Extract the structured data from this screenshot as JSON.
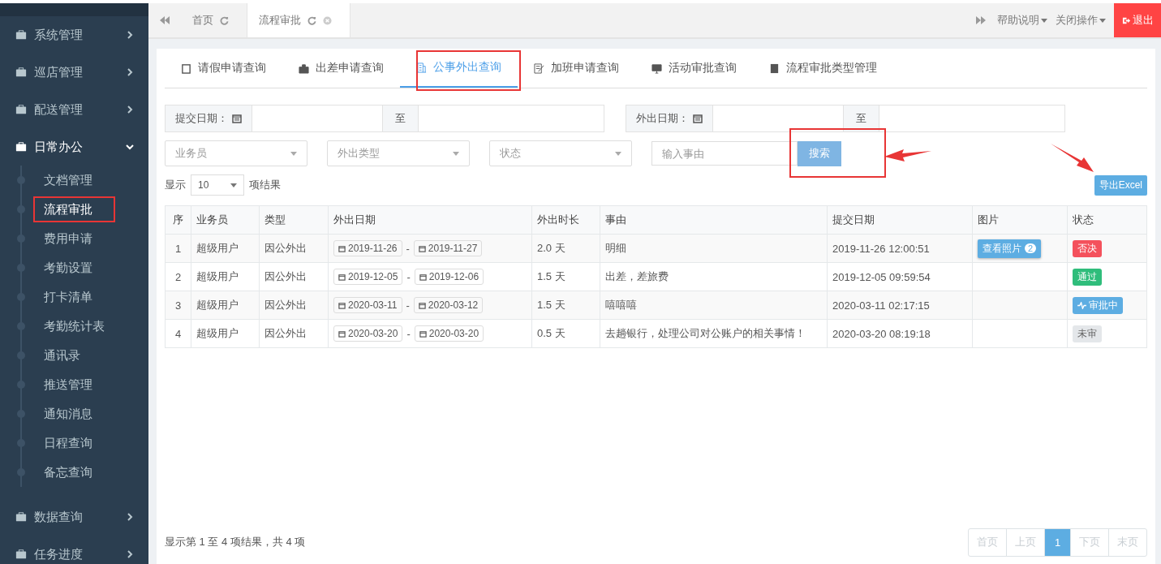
{
  "sidebar": {
    "items": [
      {
        "label": "系统管理",
        "expanded": false
      },
      {
        "label": "巡店管理",
        "expanded": false
      },
      {
        "label": "配送管理",
        "expanded": false
      },
      {
        "label": "日常办公",
        "expanded": true,
        "children": [
          {
            "label": "文档管理",
            "selected": false
          },
          {
            "label": "流程审批",
            "selected": true
          },
          {
            "label": "费用申请",
            "selected": false
          },
          {
            "label": "考勤设置",
            "selected": false
          },
          {
            "label": "打卡清单",
            "selected": false
          },
          {
            "label": "考勤统计表",
            "selected": false
          },
          {
            "label": "通讯录",
            "selected": false
          },
          {
            "label": "推送管理",
            "selected": false
          },
          {
            "label": "通知消息",
            "selected": false
          },
          {
            "label": "日程查询",
            "selected": false
          },
          {
            "label": "备忘查询",
            "selected": false
          }
        ]
      },
      {
        "label": "数据查询",
        "expanded": false
      },
      {
        "label": "任务进度",
        "expanded": false
      }
    ]
  },
  "page_tabs": [
    {
      "label": "首页",
      "selected": false,
      "closable": false
    },
    {
      "label": "流程审批",
      "selected": true,
      "closable": true
    }
  ],
  "topbar": {
    "help": "帮助说明",
    "close_ops": "关闭操作",
    "logout": "退出"
  },
  "tabs": [
    {
      "label": "请假申请查询",
      "selected": false
    },
    {
      "label": "出差申请查询",
      "selected": false
    },
    {
      "label": "公事外出查询",
      "selected": true
    },
    {
      "label": "加班申请查询",
      "selected": false
    },
    {
      "label": "活动审批查询",
      "selected": false
    },
    {
      "label": "流程审批类型管理",
      "selected": false
    }
  ],
  "filters": {
    "submit_date_label": "提交日期：",
    "to_1": "至",
    "out_date_label": "外出日期：",
    "to_2": "至",
    "selects": [
      {
        "placeholder": "业务员"
      },
      {
        "placeholder": "外出类型"
      },
      {
        "placeholder": "状态"
      }
    ],
    "reason": {
      "placeholder": "输入事由"
    },
    "search": "搜索"
  },
  "page_size": {
    "before": "显示",
    "value": "10",
    "after": "项结果"
  },
  "export": "导出Excel",
  "table": {
    "columns": [
      "序",
      "业务员",
      "类型",
      "外出日期",
      "外出时长",
      "事由",
      "提交日期",
      "图片",
      "状态"
    ],
    "rows": [
      {
        "no": "1",
        "user": "超级用户",
        "type": "因公外出",
        "from": "2019-11-26",
        "to": "2019-11-27",
        "sep": "-",
        "duration": "2.0 天",
        "reason": "明细",
        "submitted": "2019-11-26 12:00:51",
        "photo": {
          "label": "查看照片",
          "count": "2"
        },
        "status": {
          "kind": "rejected",
          "label": "否决"
        }
      },
      {
        "no": "2",
        "user": "超级用户",
        "type": "因公外出",
        "from": "2019-12-05",
        "to": "2019-12-06",
        "sep": "-",
        "duration": "1.5 天",
        "reason": "出差，差旅费",
        "submitted": "2019-12-05 09:59:54",
        "status": {
          "kind": "approved",
          "label": "通过"
        }
      },
      {
        "no": "3",
        "user": "超级用户",
        "type": "因公外出",
        "from": "2020-03-11",
        "to": "2020-03-12",
        "sep": "-",
        "duration": "1.5 天",
        "reason": "嘻嘻嘻",
        "submitted": "2020-03-11 02:17:15",
        "status": {
          "kind": "pending",
          "label": "审批中"
        }
      },
      {
        "no": "4",
        "user": "超级用户",
        "type": "因公外出",
        "from": "2020-03-20",
        "to": "2020-03-20",
        "sep": "-",
        "duration": "0.5 天",
        "reason": "去趟银行，处理公司对公账户的相关事情！",
        "submitted": "2020-03-20 08:19:18",
        "status": {
          "kind": "unreviewed",
          "label": "未审"
        }
      }
    ]
  },
  "footer": "显示第 1 至 4 项结果，共 4 项",
  "pagination": [
    {
      "label": "首页",
      "selected": false,
      "disabled": true
    },
    {
      "label": "上页",
      "selected": false,
      "disabled": true
    },
    {
      "label": "1",
      "selected": true,
      "disabled": false
    },
    {
      "label": "下页",
      "selected": false,
      "disabled": true
    },
    {
      "label": "末页",
      "selected": false,
      "disabled": true
    }
  ]
}
